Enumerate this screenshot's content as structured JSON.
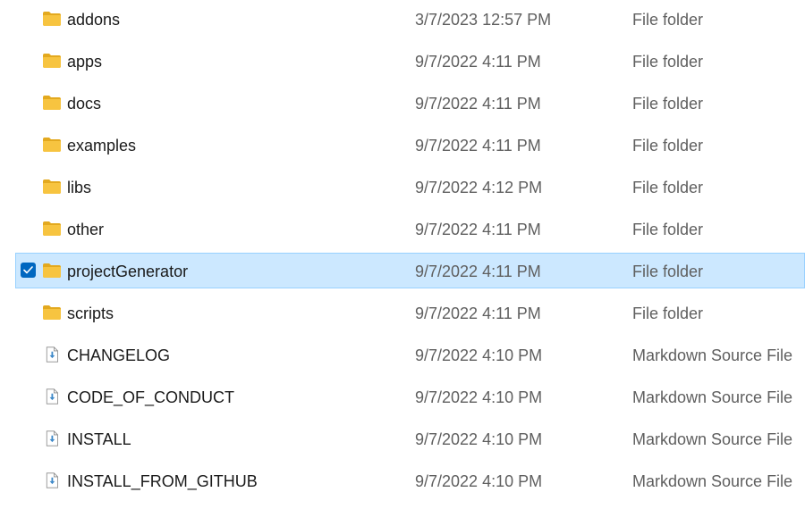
{
  "colors": {
    "selection_background": "#cce8ff",
    "selection_border": "#99d1ff",
    "checkbox": "#0067c0",
    "folder": "#f7c440",
    "markdown_arrow": "#3d88c8",
    "secondary_text": "#5f5f5f"
  },
  "file_list": {
    "items": [
      {
        "name": "addons",
        "date_modified": "3/7/2023 12:57 PM",
        "type": "File folder",
        "icon": "folder-icon",
        "selected": false
      },
      {
        "name": "apps",
        "date_modified": "9/7/2022 4:11 PM",
        "type": "File folder",
        "icon": "folder-icon",
        "selected": false
      },
      {
        "name": "docs",
        "date_modified": "9/7/2022 4:11 PM",
        "type": "File folder",
        "icon": "folder-icon",
        "selected": false
      },
      {
        "name": "examples",
        "date_modified": "9/7/2022 4:11 PM",
        "type": "File folder",
        "icon": "folder-icon",
        "selected": false
      },
      {
        "name": "libs",
        "date_modified": "9/7/2022 4:12 PM",
        "type": "File folder",
        "icon": "folder-icon",
        "selected": false
      },
      {
        "name": "other",
        "date_modified": "9/7/2022 4:11 PM",
        "type": "File folder",
        "icon": "folder-icon",
        "selected": false
      },
      {
        "name": "projectGenerator",
        "date_modified": "9/7/2022 4:11 PM",
        "type": "File folder",
        "icon": "folder-icon",
        "selected": true
      },
      {
        "name": "scripts",
        "date_modified": "9/7/2022 4:11 PM",
        "type": "File folder",
        "icon": "folder-icon",
        "selected": false
      },
      {
        "name": "CHANGELOG",
        "date_modified": "9/7/2022 4:10 PM",
        "type": "Markdown Source File",
        "icon": "markdown-file-icon",
        "selected": false
      },
      {
        "name": "CODE_OF_CONDUCT",
        "date_modified": "9/7/2022 4:10 PM",
        "type": "Markdown Source File",
        "icon": "markdown-file-icon",
        "selected": false
      },
      {
        "name": "INSTALL",
        "date_modified": "9/7/2022 4:10 PM",
        "type": "Markdown Source File",
        "icon": "markdown-file-icon",
        "selected": false
      },
      {
        "name": "INSTALL_FROM_GITHUB",
        "date_modified": "9/7/2022 4:10 PM",
        "type": "Markdown Source File",
        "icon": "markdown-file-icon",
        "selected": false
      }
    ]
  }
}
